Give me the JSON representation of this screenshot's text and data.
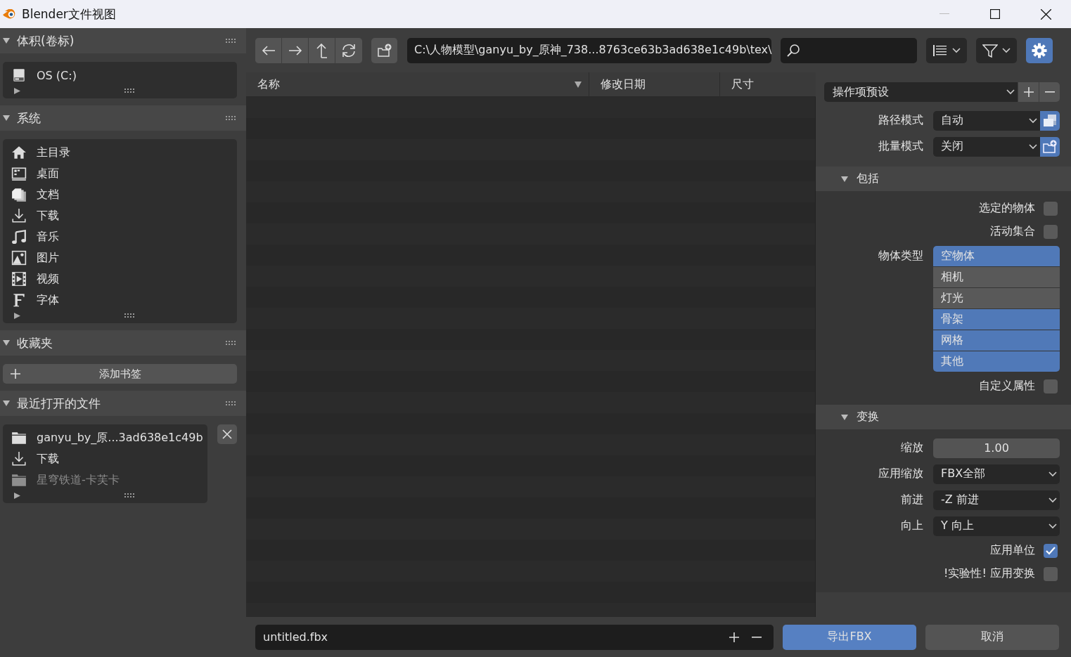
{
  "window": {
    "title": "Blender文件视图"
  },
  "sidebar": {
    "sections": [
      {
        "title": "体积(卷标)",
        "expanded": true,
        "items": [
          {
            "label": "OS (C:)",
            "disabled": false
          }
        ]
      },
      {
        "title": "系统",
        "expanded": true,
        "items": [
          {
            "label": "主目录",
            "disabled": false
          },
          {
            "label": "桌面",
            "disabled": false
          },
          {
            "label": "文档",
            "disabled": false
          },
          {
            "label": "下载",
            "disabled": false
          },
          {
            "label": "音乐",
            "disabled": false
          },
          {
            "label": "图片",
            "disabled": false
          },
          {
            "label": "视频",
            "disabled": false
          },
          {
            "label": "字体",
            "disabled": false
          }
        ]
      },
      {
        "title": "收藏夹",
        "expanded": true,
        "add_button": "添加书签"
      },
      {
        "title": "最近打开的文件",
        "expanded": true,
        "items": [
          {
            "label": "ganyu_by_原...3ad638e1c49b",
            "disabled": false
          },
          {
            "label": "下载",
            "disabled": false
          },
          {
            "label": "星穹铁道-卡芙卡",
            "disabled": true
          }
        ]
      }
    ]
  },
  "toolbar": {
    "path": "C:\\人物模型\\ganyu_by_原神_738...8763ce63b3ad638e1c49b\\tex\\",
    "settings_on": true
  },
  "file_list": {
    "columns": [
      {
        "label": "名称",
        "sorted": true
      },
      {
        "label": "修改日期",
        "sorted": false
      },
      {
        "label": "尺寸",
        "sorted": false
      }
    ]
  },
  "properties": {
    "preset": "操作项预设",
    "sections": [
      {
        "rows": [
          {
            "kind": "dropdown",
            "label": "路径模式",
            "value": "自动",
            "icon_on": true
          },
          {
            "kind": "dropdown",
            "label": "批量模式",
            "value": "关闭",
            "icon_on": true
          }
        ]
      },
      {
        "title": "包括",
        "expanded": true,
        "rows": [
          {
            "kind": "checkbox",
            "label": "选定的物体",
            "checked": false
          },
          {
            "kind": "checkbox",
            "label": "活动集合",
            "checked": false
          },
          {
            "kind": "multiselect",
            "label": "物体类型",
            "options": [
              {
                "label": "空物体",
                "selected": true
              },
              {
                "label": "相机",
                "selected": false
              },
              {
                "label": "灯光",
                "selected": false
              },
              {
                "label": "骨架",
                "selected": true
              },
              {
                "label": "网格",
                "selected": true
              },
              {
                "label": "其他",
                "selected": true
              }
            ]
          },
          {
            "kind": "checkbox",
            "label": "自定义属性",
            "checked": false
          }
        ]
      },
      {
        "title": "变换",
        "expanded": true,
        "rows": [
          {
            "kind": "number",
            "label": "缩放",
            "value": "1.00"
          },
          {
            "kind": "dropdown",
            "label": "应用缩放",
            "value": "FBX全部"
          },
          {
            "kind": "dropdown",
            "label": "前进",
            "value": "-Z 前进"
          },
          {
            "kind": "dropdown",
            "label": "向上",
            "value": "Y 向上"
          },
          {
            "kind": "checkbox",
            "label": "应用单位",
            "checked": true
          },
          {
            "kind": "checkbox",
            "label": "!实验性! 应用变换",
            "checked": false
          }
        ]
      }
    ]
  },
  "bottom": {
    "filename": "untitled.fbx",
    "buttons": [
      {
        "label": "导出FBX",
        "primary": true
      },
      {
        "label": "取消",
        "primary": false
      }
    ]
  }
}
